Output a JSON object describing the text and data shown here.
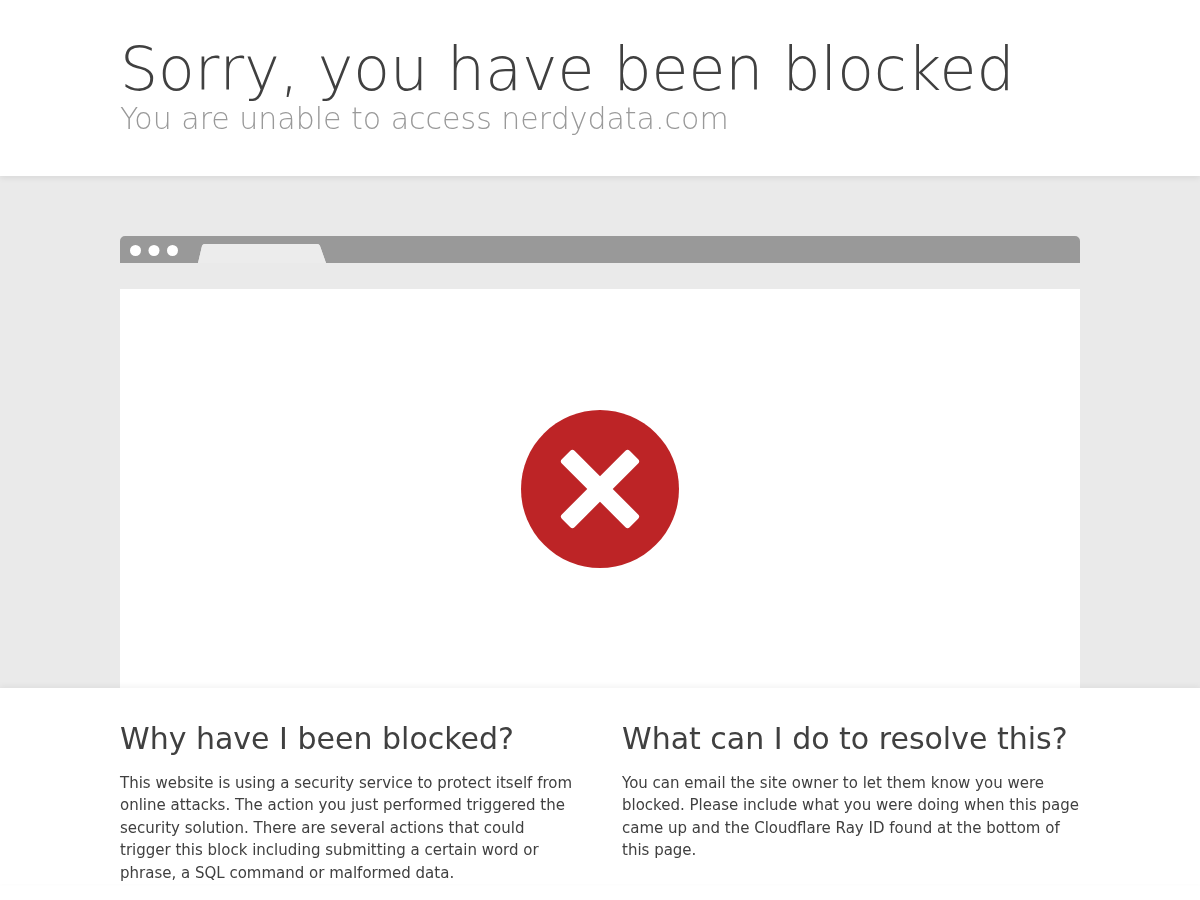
{
  "header": {
    "title": "Sorry, you have been blocked",
    "subtitle": "You are unable to access nerdydata.com"
  },
  "sections": [
    {
      "heading": "Why have I been blocked?",
      "text": "This website is using a security service to protect itself from online attacks. The action you just performed triggered the security solution. There are several actions that could trigger this block including submitting a certain word or phrase, a SQL command or malformed data."
    },
    {
      "heading": "What can I do to resolve this?",
      "text": "You can email the site owner to let them know you were blocked. Please include what you were doing when this page came up and the Cloudflare Ray ID found at the bottom of this page."
    }
  ]
}
